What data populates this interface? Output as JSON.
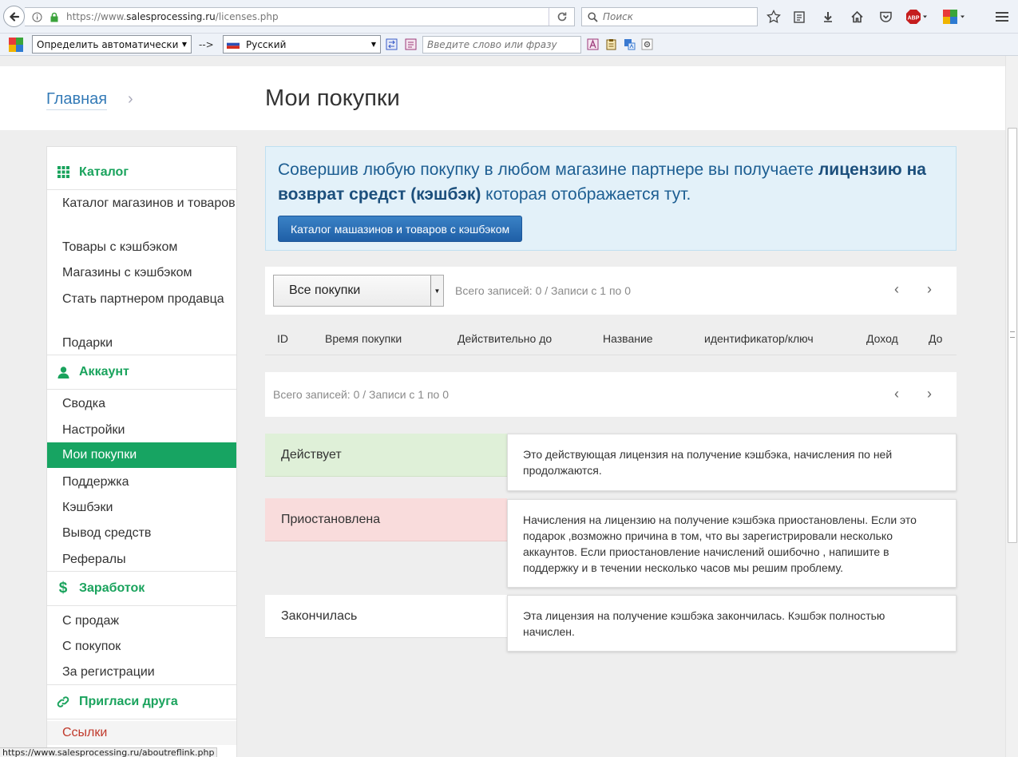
{
  "browser": {
    "url_prefix": "https://www.",
    "url_domain": "salesprocessing.ru",
    "url_path": "/licenses.php",
    "search_placeholder": "Поиск",
    "abp_label": "ABP"
  },
  "translator": {
    "source_lang": "Определить автоматически",
    "arrow": "-->",
    "target_lang": "Русский",
    "input_placeholder": "Введите слово или фразу"
  },
  "breadcrumb": {
    "home": "Главная",
    "separator": "›"
  },
  "page": {
    "title": "Мои покупки"
  },
  "sidebar": {
    "sections": [
      {
        "title": "Каталог",
        "icon": "grid-icon"
      },
      {
        "title": "Аккаунт",
        "icon": "user-icon"
      },
      {
        "title": "Заработок",
        "icon": "dollar-icon"
      },
      {
        "title": "Пригласи друга",
        "icon": "link-icon"
      }
    ],
    "catalog_items": [
      "Каталог магазинов и товаров",
      "Товары с кэшбэком",
      "Магазины с кэшбэком",
      "Стать партнером продавца",
      "Подарки"
    ],
    "account_items": [
      "Сводка",
      "Настройки",
      "Мои покупки",
      "Поддержка",
      "Кэшбэки",
      "Вывод средств",
      "Рефералы"
    ],
    "earnings_items": [
      "С продаж",
      "С покупок",
      "За регистрации"
    ],
    "invite_items": [
      "Ссылки"
    ]
  },
  "info": {
    "text_before": "Совершив любую покупку в любом магазине партнере вы получаете ",
    "text_bold": "лицензию на возврат средст (кэшбэк)",
    "text_after": " которая отображается тут.",
    "button": "Каталог машазинов и товаров с кэшбэком"
  },
  "filter": {
    "selected": "Все покупки",
    "records_info": "Всего записей: 0 / Записи с 1 по 0"
  },
  "table": {
    "columns": [
      "ID",
      "Время покупки",
      "Действительно до",
      "Название",
      "идентификатор/ключ",
      "Доход",
      "До"
    ]
  },
  "pager": {
    "prev": "‹",
    "next": "›"
  },
  "legend": [
    {
      "label": "Действует",
      "color": "#dff0d8",
      "description": "Это действующая лицензия на получение кэшбэка, начисления по ней продолжаются."
    },
    {
      "label": "Приостановлена",
      "color": "#f9dcdc",
      "description": "Начисления на лицензию на получение кэшбэка приостановлены. Если это подарок ,возможно причина в том, что вы зарегистрировали несколько аккаунтов. Если приостановление начислений ошибочно , напишите в поддержку и в течении несколько часов мы решим проблему."
    },
    {
      "label": "Закончилась",
      "color": "#ffffff",
      "description": "Эта лицензия на получение кэшбэка закончилась. Кэшбэк полностью начислен."
    }
  ],
  "status_bar": {
    "link": "https://www.salesprocessing.ru/aboutreflink.php"
  }
}
